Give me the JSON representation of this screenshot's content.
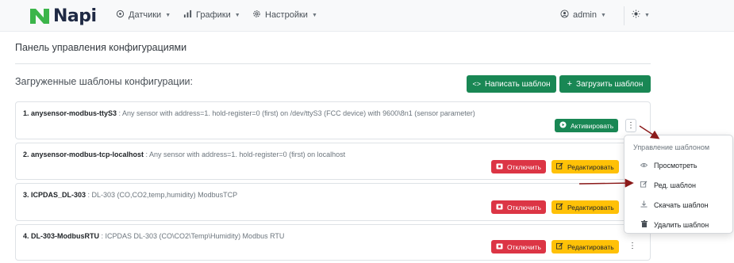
{
  "navbar": {
    "brand": "Napi",
    "items": [
      {
        "label": "Датчики",
        "icon": "sensor-icon"
      },
      {
        "label": "Графики",
        "icon": "chart-icon"
      },
      {
        "label": "Настройки",
        "icon": "gear-icon"
      }
    ],
    "user": {
      "label": "admin",
      "icon": "user-circle-icon"
    },
    "theme": {
      "icon": "sun-icon"
    }
  },
  "page": {
    "title": "Панель управления конфигурациями",
    "section_title": "Загруженные шаблоны конфигурации:",
    "write_button": "Написать шаблон",
    "upload_button": "Загрузить шаблон"
  },
  "templates": [
    {
      "name": "1. anysensor-modbus-ttyS3",
      "desc": " : Any sensor with address=1. hold-register=0 (first) on /dev/ttyS3 (FCC device) with 9600\\8n1 (sensor parameter)",
      "activate": "Активировать"
    },
    {
      "name": "2. anysensor-modbus-tcp-localhost",
      "desc": " : Any sensor with address=1. hold-register=0 (first) on localhost",
      "disable": "Отключить",
      "edit": "Редактировать"
    },
    {
      "name": "3. ICPDAS_DL-303",
      "desc": " : DL-303 (CO,CO2,temp,humidity) ModbusTCP",
      "disable": "Отключить",
      "edit": "Редактировать"
    },
    {
      "name": "4. DL-303-ModbusRTU",
      "desc": " : ICPDAS DL-303 (CO\\CO2\\Temp\\Humidity) Modbus RTU",
      "disable": "Отключить",
      "edit": "Редактировать"
    }
  ],
  "dropdown": {
    "header": "Управление шаблоном",
    "items": [
      {
        "label": "Просмотреть",
        "icon": "eye-icon"
      },
      {
        "label": "Ред. шаблон",
        "icon": "edit-icon"
      },
      {
        "label": "Скачать шаблон",
        "icon": "download-icon"
      },
      {
        "label": "Удалить шаблон",
        "icon": "trash-icon"
      }
    ]
  },
  "colors": {
    "primary_green": "#198754",
    "danger_red": "#dc3545",
    "warning_yellow": "#ffc107",
    "annotation_arrow": "#8b1a1a",
    "logo_green": "#3cb54a",
    "logo_navy": "#1f2a44"
  }
}
